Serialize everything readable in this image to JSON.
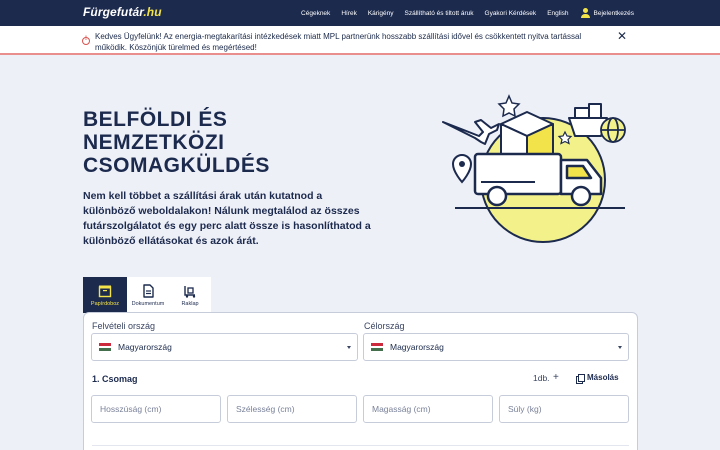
{
  "brand": {
    "logo_main": "Fürgefutár",
    "logo_tld": ".hu"
  },
  "nav": {
    "links": [
      "Cégeknek",
      "Hírek",
      "Kárigény",
      "Szállítható és tiltott áruk",
      "Gyakori Kérdések",
      "English"
    ],
    "login_label": "Bejelentkezés"
  },
  "notice": {
    "text": "Kedves Ügyfelünk! Az energia-megtakarítási intézkedések miatt MPL partnerünk hosszabb szállítási idővel és csökkentett nyitva tartással működik. Köszönjük türelmed és megértésed!",
    "close_symbol": "✕"
  },
  "hero": {
    "title_lines": [
      "BELFÖLDI ÉS",
      "NEMZETKÖZI",
      "CSOMAGKÜLDÉS"
    ],
    "description": "Nem kell többet a szállítási árak után kutatnod a különböző weboldalakon! Nálunk megtalálod az összes futárszolgálatot és egy perc alatt össze is hasonlíthatod a különböző ellátásokat és azok árát."
  },
  "tabs": [
    {
      "label": "Papírdoboz",
      "icon": "box-icon",
      "active": true
    },
    {
      "label": "Dokumentum",
      "icon": "document-icon",
      "active": false
    },
    {
      "label": "Raklap",
      "icon": "pallet-icon",
      "active": false
    }
  ],
  "form": {
    "origin_label": "Felvételi ország",
    "origin_value": "Magyarország",
    "destination_label": "Célország",
    "destination_value": "Magyarország",
    "package_title": "1. Csomag",
    "quantity": "1db.",
    "plus_symbol": "+",
    "copy_label": "Másolás",
    "placeholders": {
      "length": "Hosszúság (cm)",
      "width": "Szélesség (cm)",
      "height": "Magasság (cm)",
      "weight": "Súly (kg)"
    }
  },
  "colors": {
    "nav_bg": "#1c2a4e",
    "accent_yellow": "#f3e34a",
    "page_bg": "#eef0f7",
    "alert_red": "#d9534f",
    "flag": [
      "#cd2a3e",
      "#ffffff",
      "#436f4d"
    ]
  }
}
